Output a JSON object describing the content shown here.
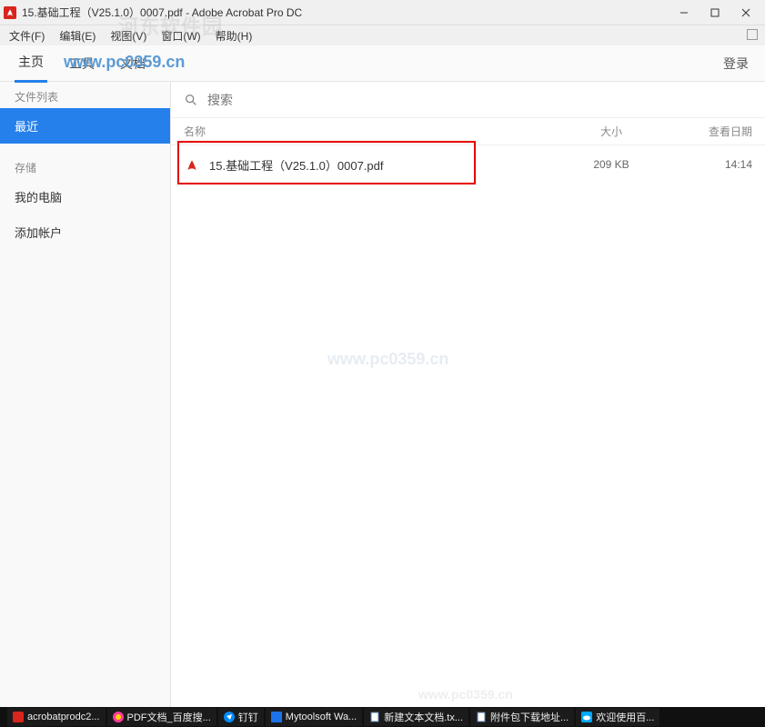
{
  "window": {
    "title": "15.基础工程（V25.1.0）0007.pdf - Adobe Acrobat Pro DC"
  },
  "menubar": {
    "file": "文件(F)",
    "edit": "编辑(E)",
    "view": "视图(V)",
    "window": "窗口(W)",
    "help": "帮助(H)"
  },
  "toolbar": {
    "tab_home": "主页",
    "tab_tools": "工具",
    "tab_doc": "文档",
    "login": "登录"
  },
  "watermarks": {
    "url": "www.pc0359.cn",
    "top": "河东软件园",
    "center": "www.pc0359.cn",
    "bottom": "www.pc0359.cn"
  },
  "sidebar": {
    "group1": "文件列表",
    "recent": "最近",
    "group2": "存储",
    "my_computer": "我的电脑",
    "add_account": "添加帐户"
  },
  "search": {
    "placeholder": "搜索"
  },
  "columns": {
    "name": "名称",
    "size": "大小",
    "date": "查看日期"
  },
  "files": [
    {
      "name": "15.基础工程（V25.1.0）0007.pdf",
      "size": "209 KB",
      "date": "14:14"
    }
  ],
  "taskbar": {
    "items": [
      {
        "label": "acrobatprodc2...",
        "color": "#d9251d"
      },
      {
        "label": "PDF文档_百度搜...",
        "color": "#ff3b9a"
      },
      {
        "label": "钉钉",
        "color": "#0089ff"
      },
      {
        "label": "Mytoolsoft Wa...",
        "color": "#1a73e8"
      },
      {
        "label": "新建文本文档.tx...",
        "color": "#5a7aa8"
      },
      {
        "label": "附件包下载地址...",
        "color": "#5a7aa8"
      },
      {
        "label": "欢迎使用百...",
        "color": "#00a8ff"
      }
    ]
  }
}
